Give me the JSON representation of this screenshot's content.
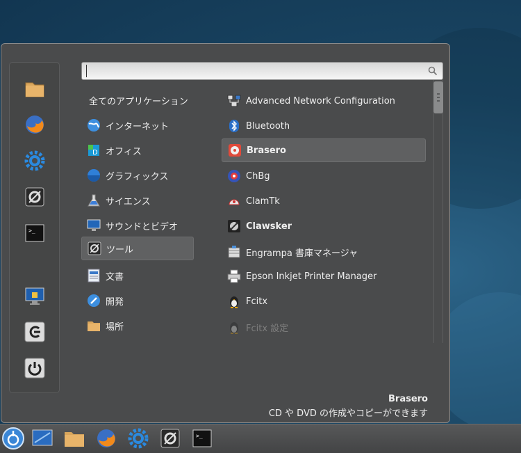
{
  "search": {
    "placeholder": "",
    "value": ""
  },
  "favorites": [
    {
      "icon": "folder-icon"
    },
    {
      "icon": "firefox-icon"
    },
    {
      "icon": "settings-gear-icon"
    },
    {
      "icon": "tools-icon"
    },
    {
      "icon": "terminal-icon"
    },
    {
      "icon": "lock-screen-icon"
    },
    {
      "icon": "logout-icon"
    },
    {
      "icon": "power-icon"
    }
  ],
  "categories": {
    "all": "全てのアプリケーション",
    "items": [
      {
        "label": "インターネット",
        "icon": "globe-icon"
      },
      {
        "label": "オフィス",
        "icon": "office-icon"
      },
      {
        "label": "グラフィックス",
        "icon": "graphics-icon"
      },
      {
        "label": "サイエンス",
        "icon": "flask-icon"
      },
      {
        "label": "サウンドとビデオ",
        "icon": "monitor-icon"
      },
      {
        "label": "ツール",
        "icon": "tools-icon"
      },
      {
        "label": "文書",
        "icon": "document-icon"
      },
      {
        "label": "開発",
        "icon": "development-icon"
      },
      {
        "label": "場所",
        "icon": "folder-icon"
      }
    ]
  },
  "apps": [
    {
      "label": "Advanced Network Configuration",
      "icon": "network-icon"
    },
    {
      "label": "Bluetooth",
      "icon": "bluetooth-icon"
    },
    {
      "label": "Brasero",
      "icon": "brasero-disc-icon"
    },
    {
      "label": "ChBg",
      "icon": "chbg-icon"
    },
    {
      "label": "ClamTk",
      "icon": "clamtk-icon"
    },
    {
      "label": "Clawsker",
      "icon": "clawsker-icon"
    },
    {
      "label": "Engrampa 書庫マネージャ",
      "icon": "archive-icon"
    },
    {
      "label": "Epson Inkjet Printer Manager",
      "icon": "printer-icon"
    },
    {
      "label": "Fcitx",
      "icon": "tux-icon"
    },
    {
      "label": "Fcitx 設定",
      "icon": "tux-icon"
    }
  ],
  "info": {
    "title": "Brasero",
    "description": "CD や DVD の作成やコピーができます"
  },
  "taskbar": [
    {
      "icon": "menu-icon"
    },
    {
      "icon": "show-desktop-icon"
    },
    {
      "icon": "folder-icon"
    },
    {
      "icon": "firefox-icon"
    },
    {
      "icon": "settings-gear-icon"
    },
    {
      "icon": "tools-icon"
    },
    {
      "icon": "terminal-icon"
    }
  ],
  "colors": {
    "menu_bg": "#4a4b4c",
    "selected_bg": "#5f6061",
    "taskbar_bg": "#4d4e4f"
  }
}
